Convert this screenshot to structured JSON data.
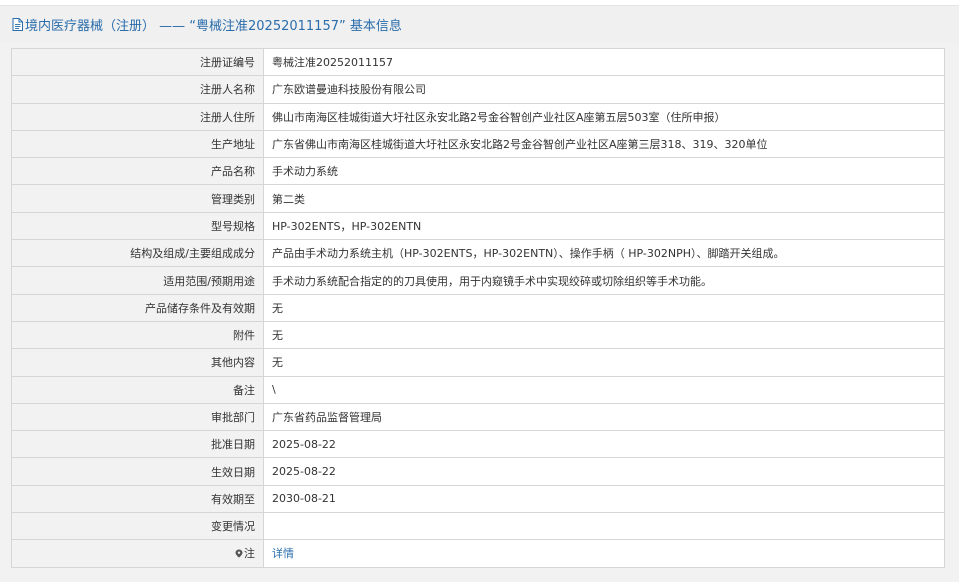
{
  "header": {
    "icon": "document-icon",
    "title": "境内医疗器械（注册） —— “粤械注准20252011157” 基本信息"
  },
  "rows": [
    {
      "name": "registration-number",
      "label": "注册证编号",
      "value": "粤械注准20252011157"
    },
    {
      "name": "registrant-name",
      "label": "注册人名称",
      "value": "广东欧谱曼迪科技股份有限公司"
    },
    {
      "name": "registrant-address",
      "label": "注册人住所",
      "value": "佛山市南海区桂城街道大圩社区永安北路2号金谷智创产业社区A座第五层503室（住所申报）"
    },
    {
      "name": "production-address",
      "label": "生产地址",
      "value": "广东省佛山市南海区桂城街道大圩社区永安北路2号金谷智创产业社区A座第三层318、319、320单位"
    },
    {
      "name": "product-name",
      "label": "产品名称",
      "value": "手术动力系统"
    },
    {
      "name": "management-class",
      "label": "管理类别",
      "value": "第二类"
    },
    {
      "name": "model-spec",
      "label": "型号规格",
      "value": "HP-302ENTS，HP-302ENTN"
    },
    {
      "name": "structure-composition",
      "label": "结构及组成/主要组成成分",
      "value": "产品由手术动力系统主机（HP-302ENTS，HP-302ENTN）、操作手柄（ HP-302NPH）、脚踏开关组成。"
    },
    {
      "name": "intended-use",
      "label": "适用范围/预期用途",
      "value": "手术动力系统配合指定的的刀具使用，用于内窥镜手术中实现绞碎或切除组织等手术功能。"
    },
    {
      "name": "storage-validity",
      "label": "产品储存条件及有效期",
      "value": "无"
    },
    {
      "name": "attachments",
      "label": "附件",
      "value": "无"
    },
    {
      "name": "other-content",
      "label": "其他内容",
      "value": "无"
    },
    {
      "name": "remarks",
      "label": "备注",
      "value": "\\"
    },
    {
      "name": "approval-dept",
      "label": "审批部门",
      "value": "广东省药品监督管理局"
    },
    {
      "name": "approval-date",
      "label": "批准日期",
      "value": "2025-08-22"
    },
    {
      "name": "effective-date",
      "label": "生效日期",
      "value": "2025-08-22"
    },
    {
      "name": "expiry-date",
      "label": "有效期至",
      "value": "2030-08-21"
    },
    {
      "name": "change-status",
      "label": "变更情况",
      "value": ""
    }
  ],
  "note": {
    "icon": "map-pin-icon",
    "label": "注",
    "link": "详情"
  },
  "colors": {
    "header_text": "#2a6dab",
    "label_bg": "#f2f2f2",
    "border": "#d6d6d6",
    "link": "#2a6dab"
  }
}
